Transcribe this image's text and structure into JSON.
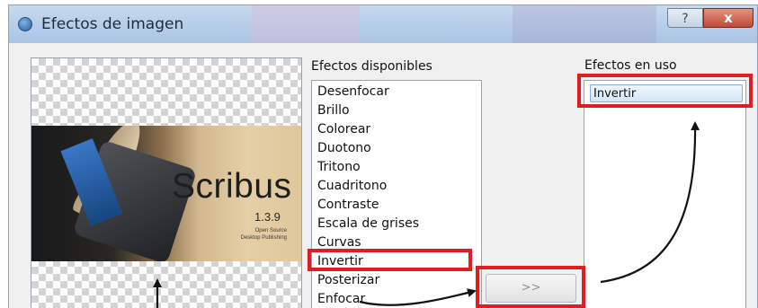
{
  "window": {
    "title": "Efectos de imagen",
    "help_label": "?",
    "close_label": "x"
  },
  "preview": {
    "app_name": "Scribus",
    "version": "1.3.9",
    "tagline_1": "Open Source",
    "tagline_2": "Desktop Publishing"
  },
  "available": {
    "label": "Efectos disponibles",
    "items": [
      "Desenfocar",
      "Brillo",
      "Colorear",
      "Duotono",
      "Tritono",
      "Cuadritono",
      "Contraste",
      "Escala de grises",
      "Curvas",
      "Invertir",
      "Posterizar",
      "Enfocar"
    ],
    "highlighted_item": "Invertir"
  },
  "in_use": {
    "label": "Efectos en uso",
    "items": [
      "Invertir"
    ]
  },
  "add_button": {
    "label": ">>"
  },
  "colors": {
    "annotation_red": "#e11d23",
    "selection_blue": "#d4e6f8",
    "arrow": "#111111"
  }
}
